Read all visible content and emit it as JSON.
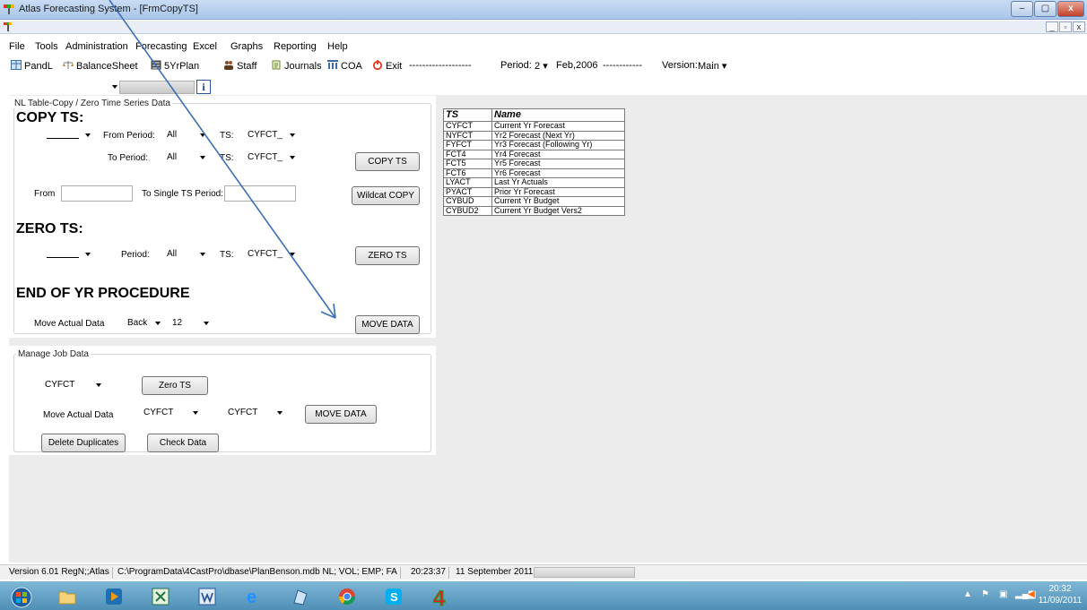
{
  "window": {
    "title": "Atlas Forecasting System - [FrmCopyTS]",
    "controls": [
      "–",
      "▢",
      "x"
    ],
    "mdi_controls": [
      "_",
      "▫",
      "x"
    ]
  },
  "menu": [
    "File",
    "Tools",
    "Administration",
    "Forecasting",
    "Excel",
    "Graphs",
    "Reporting",
    "Help"
  ],
  "toolbar": {
    "items": [
      "PandL",
      "BalanceSheet",
      "5YrPlan",
      "Staff",
      "Journals",
      "COA",
      "Exit"
    ],
    "sep1": "-------------------",
    "period_label": "Period:",
    "period_value": "2",
    "period_date": "Feb,2006",
    "sep2": "------------",
    "version_label": "Version:",
    "version_value": "Main"
  },
  "info_icon": "i",
  "copy_group": {
    "legend": "NL Table-Copy / Zero Time Series Data",
    "copy_heading": "COPY TS:",
    "from_period_label": "From Period:",
    "from_period_value": "All",
    "ts_label": "TS:",
    "from_ts_value": "CYFCT_",
    "to_period_label": "To Period:",
    "to_period_value": "All",
    "to_ts_value": "CYFCT_",
    "copy_button": "COPY TS",
    "from_label": "From",
    "to_single_label": "To Single TS Period:",
    "wildcat_button": "Wildcat COPY",
    "zero_heading": "ZERO TS:",
    "period_label": "Period:",
    "zero_period_value": "All",
    "zero_ts_value": "CYFCT_",
    "zero_button": "ZERO TS",
    "eoy_heading": "END OF YR PROCEDURE",
    "move_label": "Move Actual Data",
    "move_direction": "Back",
    "move_count": "12",
    "move_button": "MOVE DATA"
  },
  "job_group": {
    "legend": "Manage Job Data",
    "ts_value": "CYFCT",
    "zero_button": "Zero TS",
    "move_label": "Move Actual Data",
    "move_from": "CYFCT",
    "move_to": "CYFCT",
    "move_button": "MOVE DATA",
    "delete_button": "Delete Duplicates",
    "check_button": "Check Data"
  },
  "ts_table": {
    "headers": [
      "TS",
      "Name"
    ],
    "rows": [
      [
        "CYFCT",
        "Current Yr Forecast"
      ],
      [
        "NYFCT",
        "Yr2 Forecast (Next Yr)"
      ],
      [
        "FYFCT",
        "Yr3 Forecast (Following Yr)"
      ],
      [
        "FCT4",
        "Yr4 Forecast"
      ],
      [
        "FCT5",
        "Yr5 Forecast"
      ],
      [
        "FCT6",
        "Yr6 Forecast"
      ],
      [
        "LYACT",
        "Last Yr Actuals"
      ],
      [
        "PYACT",
        "Prior Yr Forecast"
      ],
      [
        "CYBUD",
        "Current Yr Budget"
      ],
      [
        "CYBUD2",
        "Current Yr Budget Vers2"
      ]
    ]
  },
  "status": {
    "version": "Version 6.01 RegN;;Atlas",
    "path": "C:\\ProgramData\\4CastPro\\dbase\\PlanBenson.mdb NL; VOL; EMP; FA",
    "time": "20:23:37",
    "date": "11 September 2011"
  },
  "taskbar": {
    "clock_time": "20:32",
    "clock_date": "11/09/2011"
  },
  "colors": {
    "arrow": "#3b6fb5",
    "client_bg": "#ececec",
    "taskbar": "#5f9fc7"
  }
}
